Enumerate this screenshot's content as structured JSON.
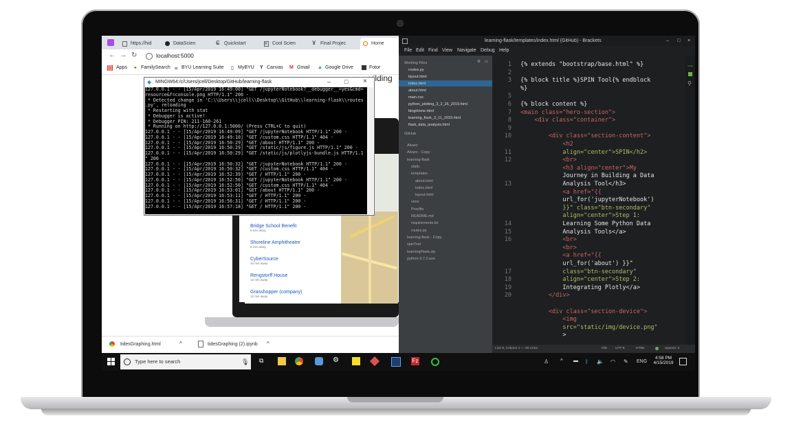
{
  "browser": {
    "tabs": [
      {
        "label": "https://hid",
        "icon": "file-icon"
      },
      {
        "label": "DataScien",
        "icon": "github-icon"
      },
      {
        "label": "Quickstart",
        "icon": "c-icon"
      },
      {
        "label": "Cool Scien",
        "icon": "file-icon"
      },
      {
        "label": "Final Projec",
        "icon": "y-icon"
      },
      {
        "label": "Home",
        "icon": "home-icon"
      }
    ],
    "address": "localhost:5000",
    "bookmarks": [
      "Apps",
      "FamilySearch",
      "BYU Learning Suite",
      "MyBYU",
      "Canvas",
      "Gmail",
      "Google Drive",
      "Fotor"
    ],
    "partial_page_text": "uilding"
  },
  "terminal": {
    "title": "MINGW64:/c/Users/jcell/Desktop/GitHub/learning-flask",
    "lines": [
      "127.0.0.1 - - [15/Apr/2019 16:49:00] \"GET /jupyterNotebook?__debugger__=yes&cmd=",
      "resource&f=console.png HTTP/1.1\" 200 -",
      " * Detected change in 'C:\\\\Users\\\\jcell\\\\Desktop\\\\GitHub\\\\learning-flask\\\\routes",
      ".py', reloading",
      " * Restarting with stat",
      " * Debugger is active!",
      " * Debugger PIN: 211-160-261",
      " * Running on http://127.0.0.1:5000/ (Press CTRL+C to quit)",
      "127.0.0.1 - - [15/Apr/2019 16:49:09] \"GET /jupyterNotebook HTTP/1.1\" 200 -",
      "127.0.0.1 - - [15/Apr/2019 16:49:10] \"GET /custom.css HTTP/1.1\" 404 -",
      "127.0.0.1 - - [15/Apr/2019 16:50:29] \"GET /about HTTP/1.1\" 200 -",
      "127.0.0.1 - - [15/Apr/2019 16:50:29] \"GET /static/js/figure.js HTTP/1.1\" 200 -",
      "127.0.0.1 - - [15/Apr/2019 16:50:29] \"GET /static/js/plotlyjs-bundle.js HTTP/1.1",
      "\" 200 -",
      "127.0.0.1 - - [15/Apr/2019 16:50:32] \"GET /jupyterNotebook HTTP/1.1\" 200 -",
      "127.0.0.1 - - [15/Apr/2019 16:50:32] \"GET /custom.css HTTP/1.1\" 404 -",
      "127.0.0.1 - - [15/Apr/2019 16:52:39] \"GET / HTTP/1.1\" 200 -",
      "127.0.0.1 - - [15/Apr/2019 16:52:50] \"GET /jupyterNotebook HTTP/1.1\" 200 -",
      "127.0.0.1 - - [15/Apr/2019 16:52:50] \"GET /custom.css HTTP/1.1\" 404 -",
      "127.0.0.1 - - [15/Apr/2019 16:53:01] \"GET /about HTTP/1.1\" 200 -",
      "127.0.0.1 - - [15/Apr/2019 16:53:11] \"GET / HTTP/1.1\" 200 -",
      "127.0.0.1 - - [15/Apr/2019 16:56:31] \"GET / HTTP/1.1\" 200 -",
      "127.0.0.1 - - [15/Apr/2019 16:57:18] \"GET / HTTP/1.1\" 200 -"
    ]
  },
  "places": [
    {
      "name": "Bridge School Benefit",
      "dist": "6 min away"
    },
    {
      "name": "Shoreline Amphitheatre",
      "dist": "6 min away"
    },
    {
      "name": "CyberSource",
      "dist": "10 min away"
    },
    {
      "name": "Rengstorff House",
      "dist": "12 min away"
    },
    {
      "name": "Grasshopper (company)",
      "dist": "12 min away"
    }
  ],
  "downloads": [
    "tidesGraphing.html",
    "tidesGraphing (2).ipynb"
  ],
  "brackets": {
    "title": "learning-flask/templates/index.html (GitHub) - Brackets",
    "menu": [
      "File",
      "Edit",
      "Find",
      "View",
      "Navigate",
      "Debug",
      "Help"
    ],
    "working_files_label": "Working Files",
    "working_files": [
      "routes.py",
      "layout.html",
      "index.html",
      "about.html",
      "main.css",
      "python_plotting_3_2_26_2019.html",
      "blogHome.html",
      "learning_flask_3_11_2019.html",
      "flask_data_analysis.html"
    ],
    "project_label": "GitHub",
    "tree": [
      "Alvaro",
      "Alvaro - Copy",
      "learning-flask",
      "static",
      "templates",
      "about.html",
      "index.html",
      "layout.html",
      "venv",
      "Procfile",
      "README.md",
      "requirements.txt",
      "routes.py",
      "learning-flask - Copy",
      "spinTool",
      "learningFlask.zip",
      "python-3.7.2.exe"
    ],
    "gutter": [
      "1",
      "2",
      "3",
      "",
      "5",
      "6",
      "7",
      "8",
      "9",
      "10",
      "",
      "11",
      "12",
      "",
      "",
      "13",
      "",
      "",
      "",
      "",
      "14",
      "15",
      "16",
      "",
      "",
      "",
      "17",
      "18",
      "19",
      "20"
    ],
    "status": "Line 6, Column 1 — 28 Lines",
    "status_right": [
      "INS",
      "UTF-8",
      "HTML",
      "Spaces: 4"
    ]
  },
  "code_lines": [
    "{% extends \"bootstrap/base.html\" %}",
    "",
    "{% block title %}SPIN Tool{% endblock",
    "%}",
    "",
    "{% block content %}",
    "<main class=\"hero-section\">",
    "    <div class=\"container\">",
    "",
    "        <div class=\"section-content\">",
    "            <h2",
    "            align=\"center\">SPIN</h2>",
    "            <br>",
    "            <h3 align=\"center\">My",
    "            Journey in Building a Data",
    "            Analysis Tool</h3>",
    "            <a href=\"{{",
    "            url_for('jupyterNotebook')",
    "            }}\" class=\"btn-secondary\"",
    "            align=\"center\">Step 1:",
    "            Learning Some Python Data",
    "            Analysis Tools</a>",
    "            <br>",
    "            <br>",
    "            <a href=\"{{",
    "            url_for('about') }}\"",
    "            class=\"btn-secondary\"",
    "            align=\"center\">Step 2:",
    "            Integrating Plotly</a>",
    "        </div>",
    "",
    "        <div class=\"section-device\">",
    "            <img",
    "            src=\"static/img/device.png\"",
    "            >"
  ],
  "taskbar": {
    "search_placeholder": "Type here to search",
    "time": "4:58 PM",
    "date": "4/15/2019",
    "lang": "ENG"
  }
}
